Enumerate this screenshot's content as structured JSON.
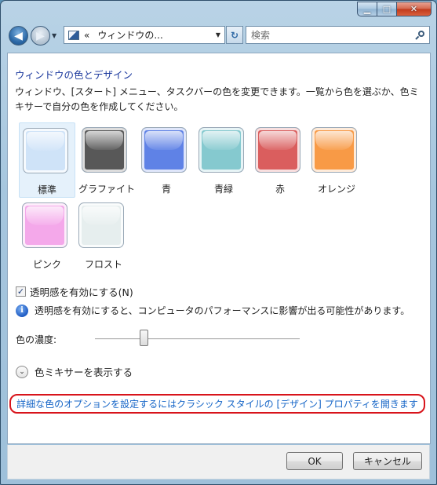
{
  "window": {
    "minimize_glyph": "▁",
    "maximize_glyph": "□",
    "close_glyph": "✕"
  },
  "navigation": {
    "back_glyph": "◀",
    "forward_glyph": "▶",
    "recent_glyph": "▼",
    "address_chevrons": "«",
    "address_text": "ウィンドウの...",
    "address_dropdown_glyph": "▼",
    "refresh_glyph": "↻",
    "search_placeholder": "検索"
  },
  "main": {
    "title": "ウィンドウの色とデザイン",
    "description": "ウィンドウ、[スタート] メニュー、タスクバーの色を変更できます。一覧から色を選ぶか、色ミキサーで自分の色を作成してください。",
    "swatches": [
      {
        "label": "標準",
        "color": "#cfe3f8",
        "selected": true
      },
      {
        "label": "グラファイト",
        "color": "#585858",
        "selected": false
      },
      {
        "label": "青",
        "color": "#5f82e6",
        "selected": false
      },
      {
        "label": "青緑",
        "color": "#85c9cf",
        "selected": false
      },
      {
        "label": "赤",
        "color": "#da5e5e",
        "selected": false
      },
      {
        "label": "オレンジ",
        "color": "#f89a46",
        "selected": false
      },
      {
        "label": "ピンク",
        "color": "#f4a8ea",
        "selected": false
      },
      {
        "label": "フロスト",
        "color": "#e6eeee",
        "selected": false
      }
    ],
    "transparency": {
      "label": "透明感を有効にする(N)",
      "checked": true,
      "check_glyph": "✓"
    },
    "info": {
      "icon_glyph": "i",
      "text": "透明感を有効にすると、コンピュータのパフォーマンスに影響が出る可能性があります。"
    },
    "intensity": {
      "label": "色の濃度:",
      "value": 0.24
    },
    "mixer": {
      "label": "色ミキサーを表示する",
      "expand_glyph": "⌄"
    },
    "classic_link": "詳細な色のオプションを設定するにはクラシック スタイルの [デザイン] プロパティを開きます",
    "highlight_color": "#d8141b"
  },
  "buttons": {
    "ok": "OK",
    "cancel": "キャンセル"
  }
}
